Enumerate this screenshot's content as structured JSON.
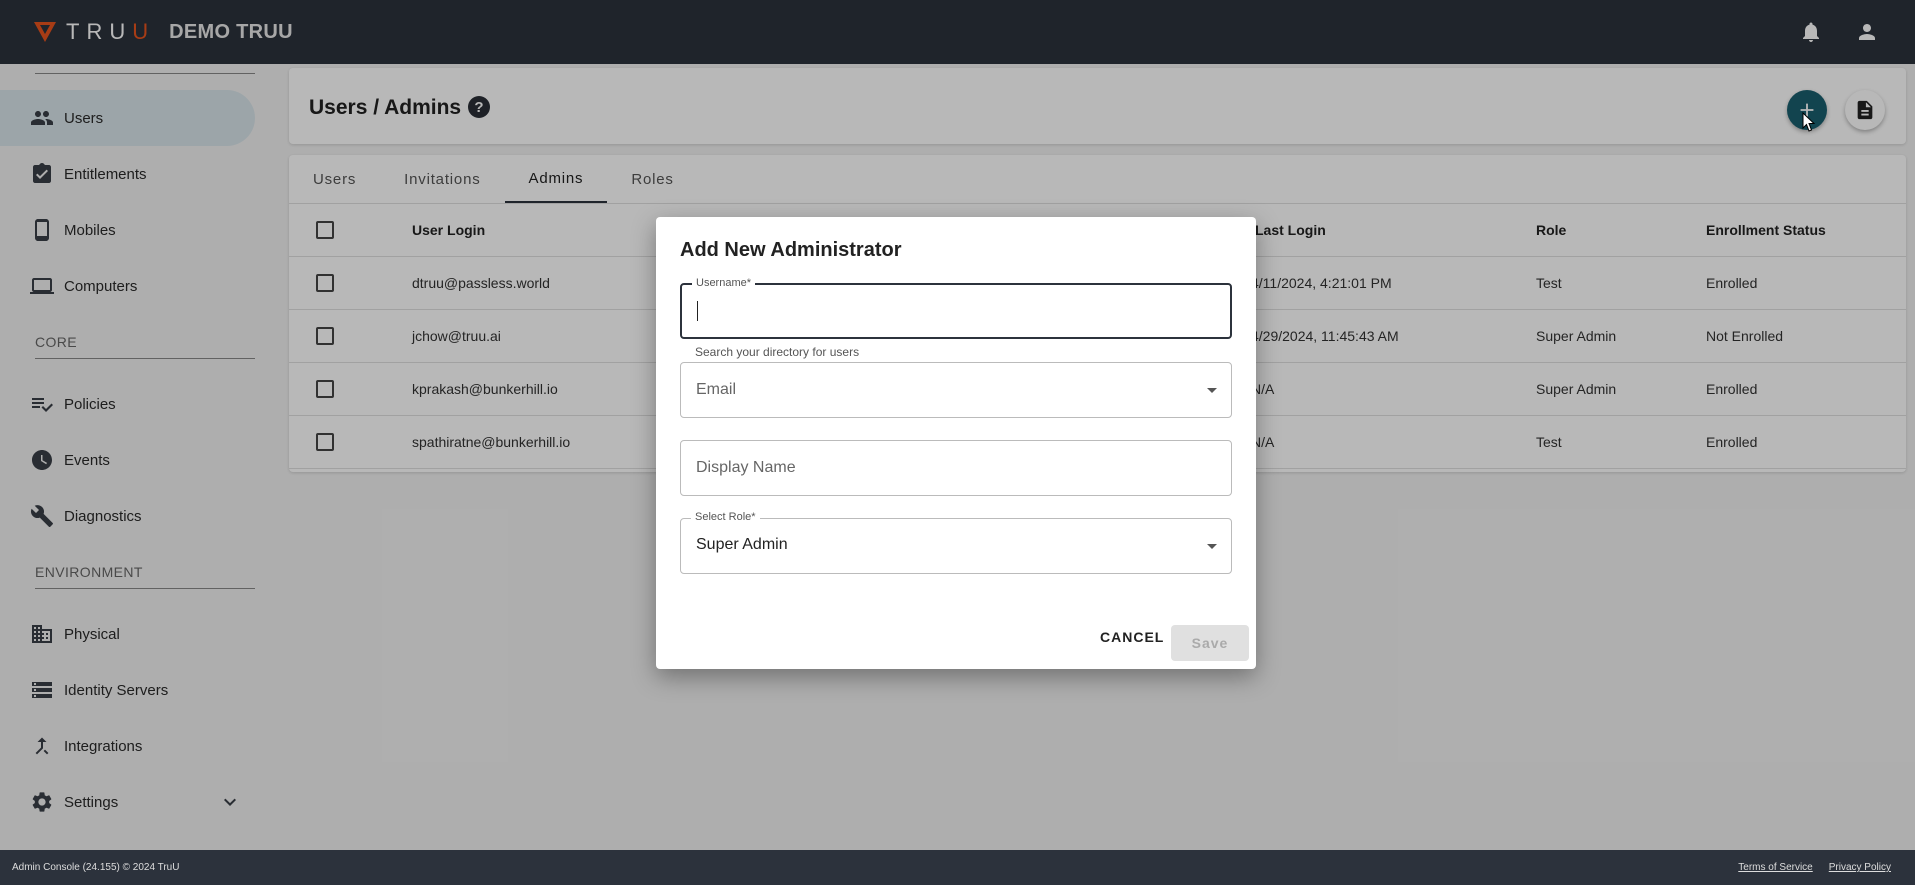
{
  "brand": {
    "logo_prefix": "TRU",
    "logo_suffix": "U",
    "tenant": "DEMO TRUU"
  },
  "sidebar": {
    "items": [
      {
        "label": "Users"
      },
      {
        "label": "Entitlements"
      },
      {
        "label": "Mobiles"
      },
      {
        "label": "Computers"
      },
      {
        "label": "Policies"
      },
      {
        "label": "Events"
      },
      {
        "label": "Diagnostics"
      },
      {
        "label": "Physical"
      },
      {
        "label": "Identity Servers"
      },
      {
        "label": "Integrations"
      },
      {
        "label": "Settings"
      }
    ],
    "sections": {
      "core": "CORE",
      "environment": "ENVIRONMENT"
    }
  },
  "header": {
    "title": "Users / Admins",
    "help": "?"
  },
  "tabs": [
    "Users",
    "Invitations",
    "Admins",
    "Roles"
  ],
  "table": {
    "columns": {
      "user_login": "User Login",
      "last_login": "Last Login",
      "role": "Role",
      "enrollment": "Enrollment Status"
    },
    "rows": [
      {
        "user": "dtruu@passless.world",
        "last_login": "4/11/2024, 4:21:01 PM",
        "role": "Test",
        "status": "Enrolled"
      },
      {
        "user": "jchow@truu.ai",
        "last_login": "4/29/2024, 11:45:43 AM",
        "role": "Super Admin",
        "status": "Not Enrolled"
      },
      {
        "user": "kprakash@bunkerhill.io",
        "last_login": "N/A",
        "role": "Super Admin",
        "status": "Enrolled"
      },
      {
        "user": "spathiratne@bunkerhill.io",
        "last_login": "N/A",
        "role": "Test",
        "status": "Enrolled"
      }
    ]
  },
  "dialog": {
    "title": "Add New Administrator",
    "username_label": "Username*",
    "username_value": "",
    "username_helper": "Search your directory for users",
    "email_placeholder": "Email",
    "display_name_placeholder": "Display Name",
    "role_label": "Select Role*",
    "role_value": "Super Admin",
    "cancel": "Cancel",
    "save": "Save"
  },
  "footer": {
    "left": "Admin Console (24.155) © 2024 TruU",
    "terms": "Terms of Service",
    "privacy": "Privacy Policy"
  },
  "colors": {
    "topbar": "#2c323c",
    "brand_orange": "#e8541e",
    "accent_teal": "#1a5f6e",
    "active_nav": "#d9e5ea"
  }
}
